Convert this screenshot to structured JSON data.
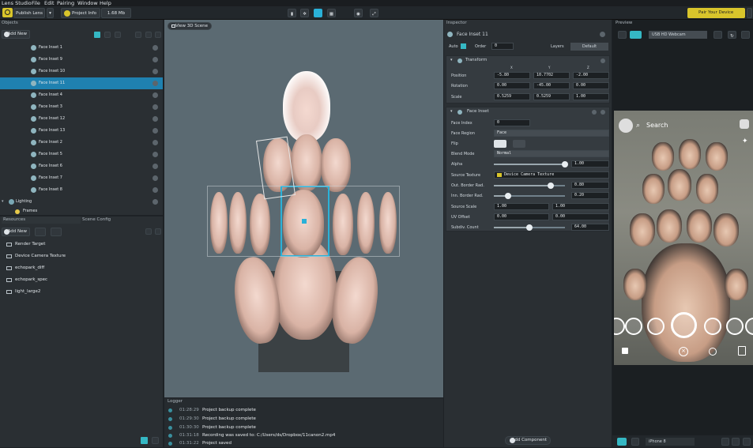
{
  "menubar": {
    "items": [
      "Lens Studio",
      "File",
      "Edit",
      "Pairing",
      "Window",
      "Help"
    ]
  },
  "toolbar": {
    "publish_label": "Publish Lens",
    "project_info_label": "Project Info",
    "size_label": "1.68 Mb",
    "pair_label": "Pair Your Device"
  },
  "objects": {
    "title": "Objects",
    "add_new": "Add New",
    "items": [
      "Face Inset 1",
      "Face Inset 9",
      "Face Inset 10",
      "Face Inset 11",
      "Face Inset 4",
      "Face Inset 3",
      "Face Inset 12",
      "Face Inset 13",
      "Face Inset 2",
      "Face Inset 5",
      "Face Inset 6",
      "Face Inset 7",
      "Face Inset 8"
    ],
    "selected_index": 3,
    "lighting": "Lighting",
    "frames": "Frames"
  },
  "resources": {
    "title": "Resources",
    "tab2": "Scene Config",
    "add_new": "Add New",
    "items": [
      "Render Target",
      "Device Camera Texture",
      "echopark_diff",
      "echopark_spec",
      "light_large2"
    ]
  },
  "viewport": {
    "view_3d_label": "View 3D Scene"
  },
  "logger": {
    "title": "Logger",
    "rows": [
      {
        "time": "01:28:29",
        "msg": "Project backup complete"
      },
      {
        "time": "01:29:30",
        "msg": "Project backup complete"
      },
      {
        "time": "01:30:30",
        "msg": "Project backup complete"
      },
      {
        "time": "01:31:18",
        "msg": "Recording was saved to:  C:/Users/ds/Dropbox/11canon2.mp4"
      },
      {
        "time": "01:31:22",
        "msg": "Project saved"
      }
    ]
  },
  "inspector": {
    "title": "Inspector",
    "object_name": "Face Inset 11",
    "auto": "Auto",
    "order_label": "Order",
    "order_value": "0",
    "layers_label": "Layers",
    "layers_value": "Default",
    "transform": {
      "title": "Transform",
      "axes": [
        "X",
        "Y",
        "Z"
      ],
      "position_label": "Position",
      "position": [
        "-5.80",
        "10.7702",
        "-2.00"
      ],
      "rotation_label": "Rotation",
      "rotation": [
        "0.00",
        "-45.00",
        "0.00"
      ],
      "scale_label": "Scale",
      "scale": [
        "0.5259",
        "0.5259",
        "1.00"
      ]
    },
    "face_inset": {
      "title": "Face Inset",
      "face_index_label": "Face Index",
      "face_index": "0",
      "face_region_label": "Face Region",
      "face_region": "Face",
      "flip_label": "Flip",
      "blend_mode_label": "Blend Mode",
      "blend_mode": "Normal",
      "alpha_label": "Alpha",
      "alpha": "1.00",
      "alpha_level": 1.0,
      "source_texture_label": "Source Texture",
      "source_texture": "Device Camera Texture",
      "outer_border_label": "Out. Border Rad.",
      "outer_border": "0.80",
      "outer_border_level": 0.8,
      "inner_border_label": "Inn. Border Rad.",
      "inner_border": "0.20",
      "inner_border_level": 0.2,
      "source_scale_label": "Source Scale",
      "source_scale": [
        "1.00",
        "1.00"
      ],
      "uv_offset_label": "UV Offset",
      "uv_offset": [
        "0.00",
        "0.00"
      ],
      "subdiv_label": "Subdiv. Count",
      "subdiv": "64.00",
      "subdiv_level": 0.5
    },
    "add_component": "Add Component"
  },
  "preview": {
    "title": "Preview",
    "camera_source": "USB HD Webcam",
    "search_label": "Search",
    "device": "iPhone 8"
  },
  "colors": {
    "accent_blue": "#1f81b0",
    "yellow": "#d9c52b",
    "teal": "#3a8f9e",
    "selection": "#2ab1d8"
  }
}
